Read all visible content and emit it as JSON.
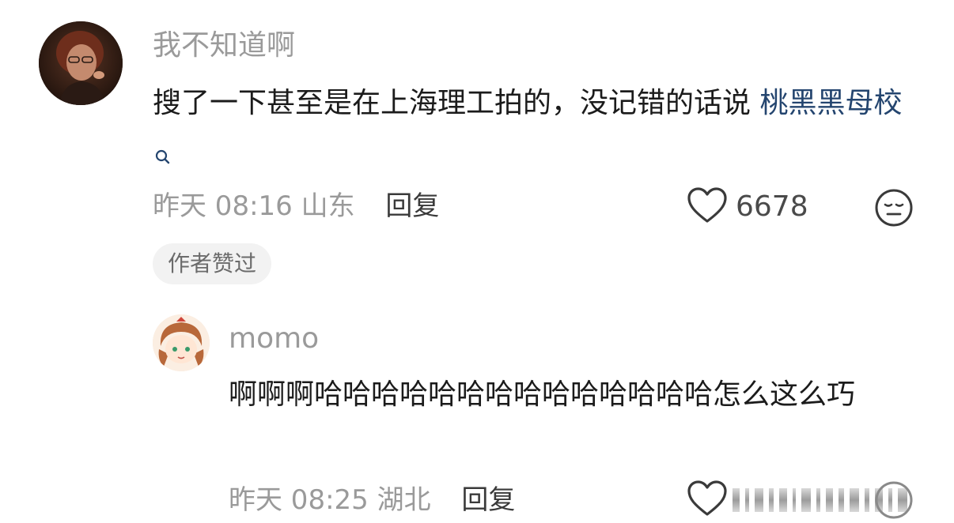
{
  "main_comment": {
    "username": "我不知道啊",
    "content_text": "搜了一下甚至是在上海理工拍的，没记错的话说 ",
    "content_link": "桃黑黑母校",
    "time": "昨天 08:16",
    "location": "山东",
    "reply_label": "回复",
    "like_count": "6678",
    "author_liked_badge": "作者赞过",
    "icons": {
      "like": "heart-outline-icon",
      "react": "neutral-face-icon",
      "search": "search-icon"
    }
  },
  "reply_comment": {
    "username": "momo",
    "content_text": "啊啊啊哈哈哈哈哈哈哈哈哈哈哈哈哈哈怎么这么巧",
    "time": "昨天 08:25",
    "location": "湖北",
    "reply_label": "回复",
    "icons": {
      "like": "heart-outline-icon",
      "react": "neutral-face-icon"
    }
  },
  "colors": {
    "link": "#24456f",
    "muted_text": "#9a9a9a",
    "body_text": "#1b1b1b",
    "badge_bg": "#f2f2f2"
  }
}
